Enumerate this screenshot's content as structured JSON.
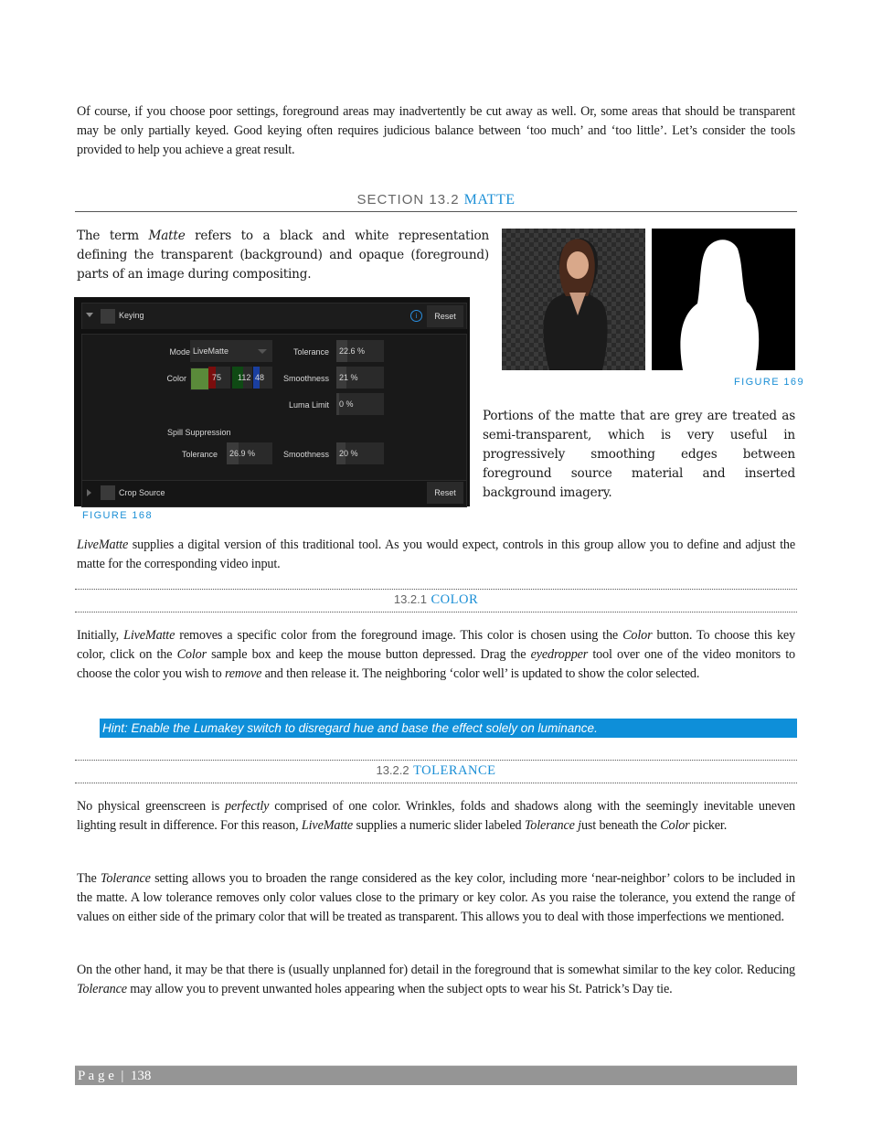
{
  "intro": {
    "text": "Of course, if you choose poor settings, foreground areas may inadvertently be cut away as well. Or, some areas that should be transparent may be only partially keyed.  Good keying often requires judicious balance between ‘too much’ and ‘too little’.  Let’s consider the tools provided to help you achieve a great result."
  },
  "section": {
    "number": "SECTION 13.2",
    "title": "MATTE"
  },
  "matte_para": {
    "p1": "The term ",
    "em": "Matte",
    "p2": " refers to a black and white representation defining the transparent (background) and opaque (foreground) parts of an image during compositing."
  },
  "figure168": {
    "caption": "FIGURE 168",
    "keying": {
      "header_label": "Keying",
      "info_icon": "info-icon",
      "reset_label": "Reset",
      "mode_label": "Mode",
      "mode_value": "LiveMatte",
      "color_label": "Color",
      "color_swatch": "#5a8a3a",
      "rgb": {
        "r": "75",
        "g": "112",
        "b": "48"
      },
      "tolerance_label": "Tolerance",
      "tolerance_value": "22.6 %",
      "tolerance_fraction": 0.226,
      "smoothness_label": "Smoothness",
      "smoothness_value": "21 %",
      "smoothness_fraction": 0.21,
      "luma_label": "Luma Limit",
      "luma_value": "0 %",
      "luma_fraction": 0.0,
      "spill_label": "Spill Suppression",
      "spill_tolerance_label": "Tolerance",
      "spill_tolerance_value": "26.9 %",
      "spill_tolerance_fraction": 0.269,
      "spill_smoothness_label": "Smoothness",
      "spill_smoothness_value": "20 %",
      "spill_smoothness_fraction": 0.2
    },
    "crop": {
      "label": "Crop Source",
      "reset_label": "Reset"
    }
  },
  "figure169": {
    "caption": "FIGURE 169"
  },
  "grey_para": "Portions of the matte that are grey are treated as semi-transparent, which is very useful in progressively smoothing edges between foreground source material and inserted background imagery.",
  "livematte_para": {
    "em": "LiveMatte",
    "rest": " supplies a digital version of this traditional tool.  As you would expect, controls in this group allow you to define and adjust the matte for the corresponding video input."
  },
  "sub1": {
    "number": "13.2.1",
    "title": "COLOR"
  },
  "color_para": {
    "a": "Initially, ",
    "b": "LiveMatte",
    "c": " removes a specific color from the foreground image. This color is chosen using the ",
    "d": "Color",
    "e": " button. To choose this key color, click on the ",
    "f": "Color",
    "g": " sample box and keep the mouse button depressed.  Drag the ",
    "h": "eyedropper",
    "i": " tool over one of the video monitors to choose the color you wish to ",
    "j": "remove",
    "k": " and then release it. The neighboring ‘color well’ is updated to show the color selected."
  },
  "hint": "Hint: Enable the Lumakey switch to disregard hue and base the effect solely on luminance.",
  "sub2": {
    "number": "13.2.2",
    "title": "TOLERANCE"
  },
  "tol_para1": {
    "a": "No physical greenscreen is ",
    "b": "perfectly",
    "c": " comprised of one color.  Wrinkles, folds and shadows along with the seemingly inevitable uneven lighting result in difference.  For this reason, ",
    "d": "LiveMatte",
    "e": " supplies a numeric slider labeled ",
    "f": "Tolerance j",
    "g": "ust beneath the ",
    "h": "Color",
    "i": " picker."
  },
  "tol_para2": {
    "a": "The ",
    "b": "Tolerance",
    "c": " setting allows you to broaden the range considered as the key color, including more ‘near-neighbor’ colors to be included in the matte.  A low tolerance removes only color values close to the primary or key color.  As you raise the tolerance, you extend the range of values on either side of the primary color that will be treated as transparent.  This allows you to deal with those imperfections we mentioned."
  },
  "tol_para3": {
    "a": "On the other hand, it may be that there is (usually unplanned for) detail in the foreground that is somewhat similar to the key color.  Reducing ",
    "b": "Tolerance",
    "c": " may allow you to prevent unwanted holes appearing when the subject opts to wear his St. Patrick’s Day tie."
  },
  "footer": {
    "label": "P a g e  |  138"
  }
}
